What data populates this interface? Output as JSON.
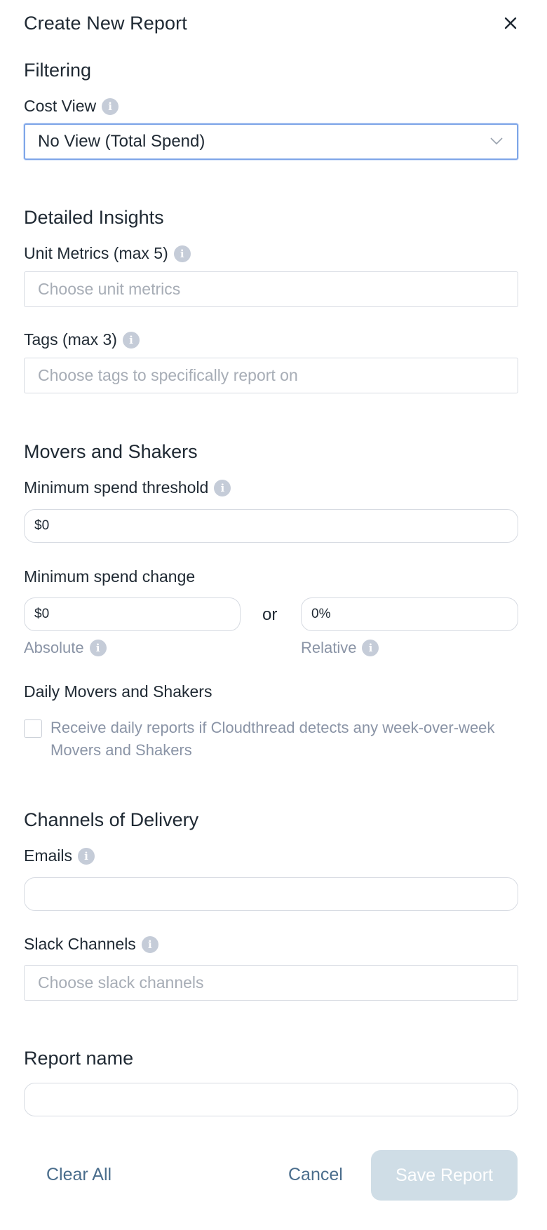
{
  "header": {
    "title": "Create New Report"
  },
  "filtering": {
    "section_title": "Filtering",
    "cost_view_label": "Cost View",
    "cost_view_value": "No View (Total Spend)"
  },
  "detailed_insights": {
    "section_title": "Detailed Insights",
    "unit_metrics_label": "Unit Metrics (max 5)",
    "unit_metrics_placeholder": "Choose unit metrics",
    "tags_label": "Tags (max 3)",
    "tags_placeholder": "Choose tags to specifically report on"
  },
  "movers": {
    "section_title": "Movers and Shakers",
    "min_threshold_label": "Minimum spend threshold",
    "min_threshold_value": "$0",
    "min_change_label": "Minimum spend change",
    "absolute_value": "$0",
    "or_label": "or",
    "relative_value": "0%",
    "absolute_label": "Absolute",
    "relative_label": "Relative",
    "daily_label": "Daily Movers and Shakers",
    "daily_checkbox_text": "Receive daily reports if Cloudthread detects any week-over-week Movers and Shakers",
    "daily_checked": false
  },
  "delivery": {
    "section_title": "Channels of Delivery",
    "emails_label": "Emails",
    "emails_value": "",
    "slack_label": "Slack Channels",
    "slack_placeholder": "Choose slack channels"
  },
  "report": {
    "name_label": "Report name",
    "name_value": ""
  },
  "footer": {
    "clear_label": "Clear All",
    "cancel_label": "Cancel",
    "save_label": "Save Report"
  },
  "icons": {
    "close": "close-icon",
    "info": "info-icon",
    "chevron": "chevron-down-icon"
  },
  "colors": {
    "link": "#4a6d8c",
    "save_disabled_bg": "#cfdde6",
    "focus_border": "#7fa6e8",
    "info_icon": "#c5ccd8"
  }
}
